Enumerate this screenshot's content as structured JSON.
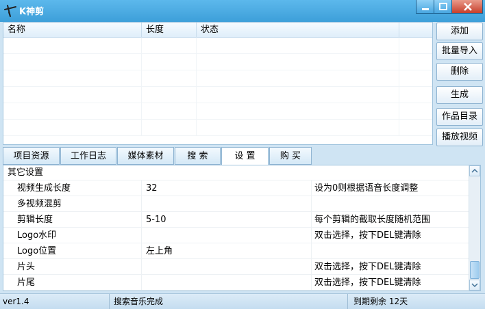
{
  "window": {
    "title": "K神剪"
  },
  "list": {
    "columns": [
      "名称",
      "长度",
      "状态"
    ],
    "rows": []
  },
  "actions": {
    "add": "添加",
    "batch_import": "批量导入",
    "delete": "删除",
    "generate": "生成",
    "works_dir": "作品目录",
    "play_video": "播放视频"
  },
  "tabs": [
    {
      "label": "项目资源"
    },
    {
      "label": "工作日志"
    },
    {
      "label": "媒体素材"
    },
    {
      "label": "搜 索"
    },
    {
      "label": "设 置",
      "active": true
    },
    {
      "label": "购 买"
    }
  ],
  "settings": {
    "section": "其它设置",
    "rows": [
      {
        "name": "视频生成长度",
        "value": "32",
        "note": "设为0则根据语音长度调整"
      },
      {
        "name": "多视频混剪",
        "value": "",
        "note": ""
      },
      {
        "name": "剪辑长度",
        "value": "5-10",
        "note": "每个剪辑的截取长度随机范围"
      },
      {
        "name": "Logo水印",
        "value": "",
        "note": "双击选择，按下DEL键清除"
      },
      {
        "name": "Logo位置",
        "value": "左上角",
        "note": ""
      },
      {
        "name": "片头",
        "value": "",
        "note": "双击选择，按下DEL键清除"
      },
      {
        "name": "片尾",
        "value": "",
        "note": "双击选择，按下DEL键清除"
      }
    ]
  },
  "status": {
    "version": "ver1.4",
    "message": "搜索音乐完成",
    "expiry": "到期剩余 12天"
  },
  "colors": {
    "titlebar": "#3d9fd9",
    "close": "#c7402c",
    "accent": "#8fb4d2"
  }
}
